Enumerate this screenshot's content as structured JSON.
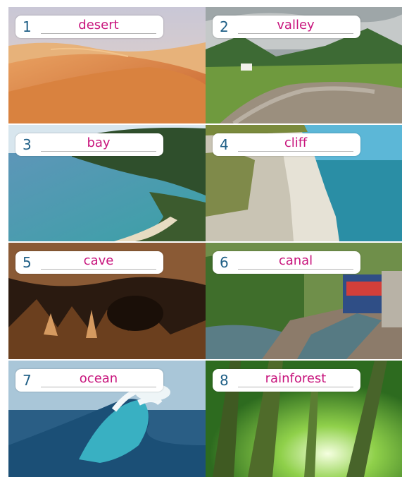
{
  "items": [
    {
      "number": "1",
      "word": "desert"
    },
    {
      "number": "2",
      "word": "valley"
    },
    {
      "number": "3",
      "word": "bay"
    },
    {
      "number": "4",
      "word": "cliff"
    },
    {
      "number": "5",
      "word": "cave"
    },
    {
      "number": "6",
      "word": "canal"
    },
    {
      "number": "7",
      "word": "ocean"
    },
    {
      "number": "8",
      "word": "rainforest"
    }
  ],
  "colors": {
    "number": "#1f5f86",
    "answer": "#c8157d",
    "label_bg": "#ffffff"
  }
}
